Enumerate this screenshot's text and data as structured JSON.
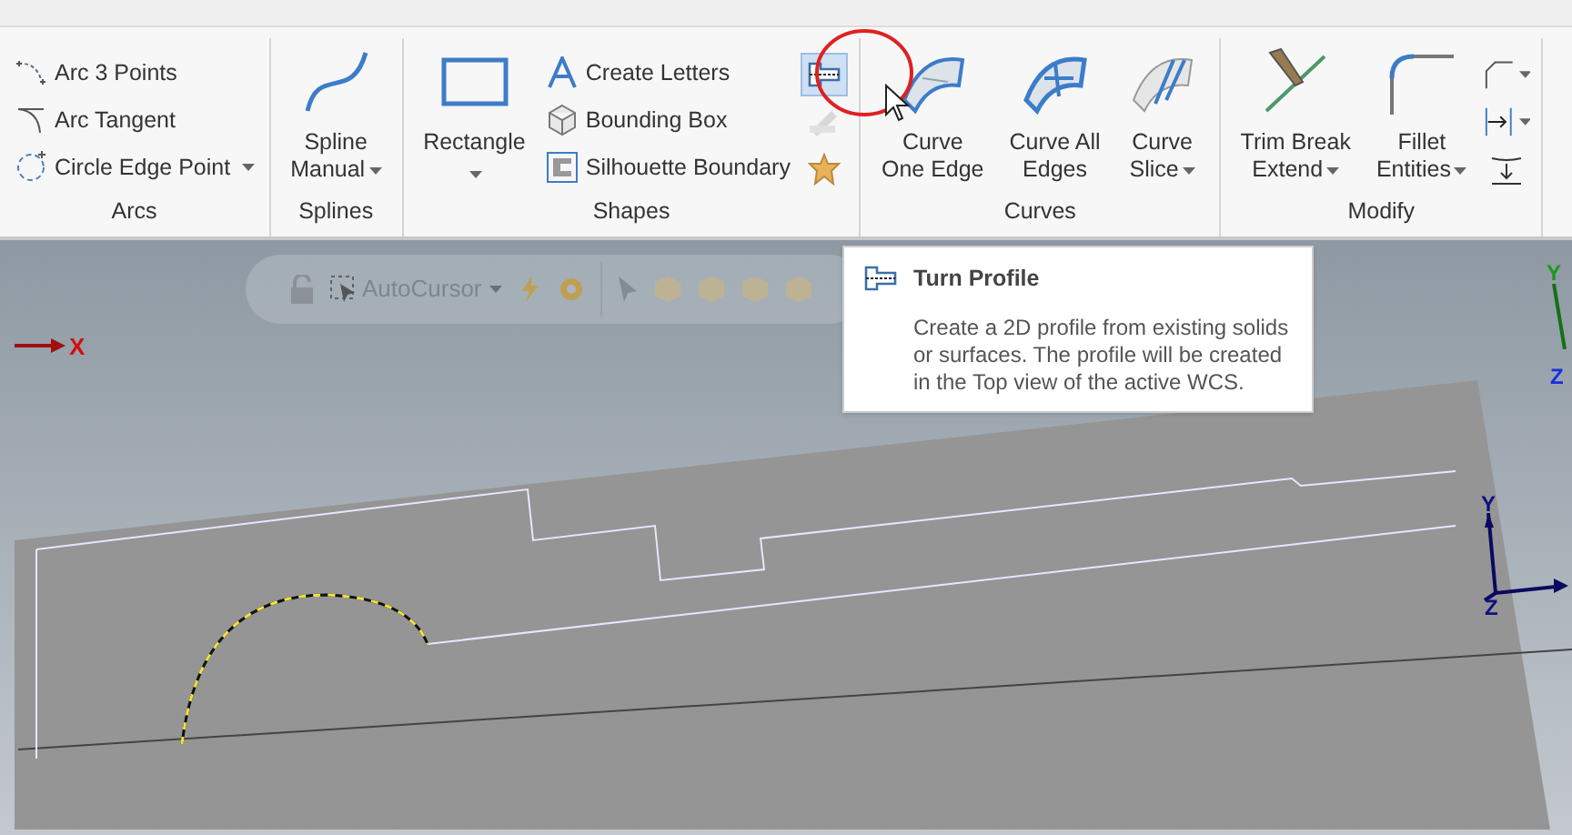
{
  "ribbon": {
    "groups": [
      {
        "label": "Arcs",
        "items": [
          {
            "kind": "small",
            "label": "Arc 3 Points",
            "dropdown": false
          },
          {
            "kind": "small",
            "label": "Arc Tangent",
            "dropdown": false
          },
          {
            "kind": "small",
            "label": "Circle Edge Point",
            "dropdown": true
          }
        ]
      },
      {
        "label": "Splines",
        "items": [
          {
            "kind": "large",
            "lines": [
              "Spline",
              "Manual"
            ],
            "dropdown": true
          }
        ]
      },
      {
        "label": "Shapes",
        "items": [
          {
            "kind": "large",
            "lines": [
              "Rectangle"
            ],
            "dropdown": true
          },
          {
            "kind": "small",
            "label": "Create Letters",
            "dropdown": false
          },
          {
            "kind": "small",
            "label": "Bounding Box",
            "dropdown": false
          },
          {
            "kind": "small",
            "label": "Silhouette Boundary",
            "dropdown": false
          },
          {
            "kind": "icon",
            "selected": true,
            "disabled": false
          },
          {
            "kind": "icon",
            "selected": false,
            "disabled": true
          },
          {
            "kind": "icon",
            "selected": false,
            "disabled": false
          }
        ]
      },
      {
        "label": "Curves",
        "items": [
          {
            "kind": "large",
            "lines": [
              "Curve",
              "One Edge"
            ],
            "dropdown": false
          },
          {
            "kind": "large",
            "lines": [
              "Curve All",
              "Edges"
            ],
            "dropdown": false
          },
          {
            "kind": "large",
            "lines": [
              "Curve",
              "Slice"
            ],
            "dropdown": true
          }
        ]
      },
      {
        "label": "Modify",
        "items": [
          {
            "kind": "large",
            "lines": [
              "Trim Break",
              "Extend"
            ],
            "dropdown": true
          },
          {
            "kind": "large",
            "lines": [
              "Fillet",
              "Entities"
            ],
            "dropdown": true
          },
          {
            "kind": "icon",
            "selected": false,
            "disabled": false,
            "dropdown": true
          },
          {
            "kind": "icon",
            "selected": false,
            "disabled": false,
            "dropdown": true
          },
          {
            "kind": "icon",
            "selected": false,
            "disabled": false,
            "dropdown": false
          }
        ]
      }
    ]
  },
  "floating_toolbar": {
    "selection_mode": "AutoCursor"
  },
  "tooltip": {
    "title": "Turn Profile",
    "body": "Create a 2D profile from existing solids or surfaces. The profile will be created in the Top view of the active WCS."
  },
  "axes": {
    "x_label": "X",
    "view_y_label": "Y",
    "view_z_label": "Z",
    "wcs_y_label": "Y",
    "wcs_z_label": "Z"
  }
}
